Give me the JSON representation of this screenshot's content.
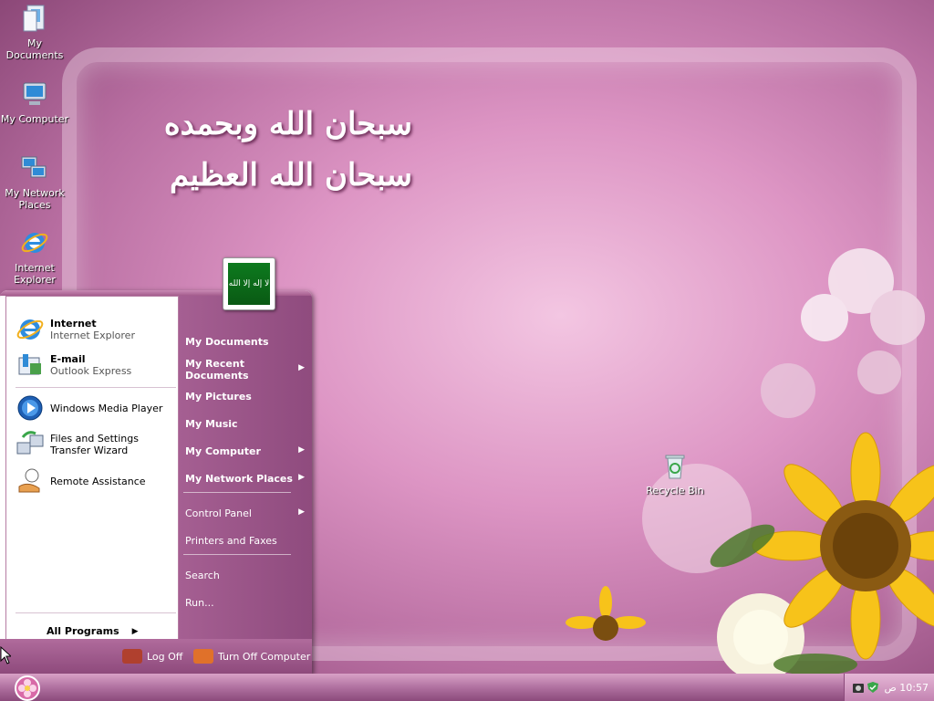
{
  "wallpaper": {
    "line1": "سبحان الله وبحمده",
    "line2": "سبحان الله العظيم"
  },
  "desktop": {
    "icons": [
      {
        "label": "My Documents",
        "icon": "my-documents-icon"
      },
      {
        "label": "My Computer",
        "icon": "my-computer-icon"
      },
      {
        "label": "My Network Places",
        "icon": "network-places-icon"
      },
      {
        "label": "Internet Explorer",
        "icon": "internet-explorer-icon"
      },
      {
        "label": "Recycle Bin",
        "icon": "recycle-bin-icon"
      }
    ]
  },
  "start_menu": {
    "user_picture_text": "لا إله إلا الله",
    "pinned": [
      {
        "title": "Internet",
        "subtitle": "Internet Explorer",
        "icon": "internet-explorer-icon"
      },
      {
        "title": "E-mail",
        "subtitle": "Outlook Express",
        "icon": "outlook-express-icon"
      }
    ],
    "recent": [
      {
        "label": "Windows Media Player",
        "icon": "media-player-icon"
      },
      {
        "label": "Files and Settings Transfer Wizard",
        "icon": "transfer-wizard-icon"
      },
      {
        "label": "Remote Assistance",
        "icon": "remote-assistance-icon"
      }
    ],
    "all_programs": "All Programs",
    "places": [
      {
        "label": "My Documents"
      },
      {
        "label": "My Recent Documents"
      },
      {
        "label": "My Pictures"
      },
      {
        "label": "My Music"
      },
      {
        "label": "My Computer"
      },
      {
        "label": "My Network Places"
      },
      {
        "label": "Control Panel"
      },
      {
        "label": "Printers and Faxes"
      },
      {
        "label": "Search"
      },
      {
        "label": "Run..."
      }
    ],
    "log_off": "Log Off",
    "turn_off": "Turn Off Computer"
  },
  "taskbar": {
    "clock": "10:57 ص"
  },
  "colors": {
    "accent": "#a55f92",
    "taskbar": "#b071a0"
  }
}
